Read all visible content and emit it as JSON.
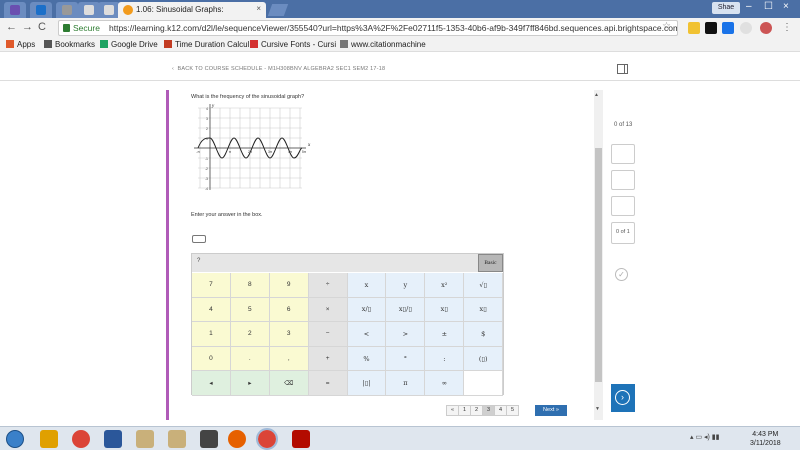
{
  "browser": {
    "active_tab_title": "1.06: Sinusoidal Graphs:",
    "tab_close": "×",
    "user_chip": "Shae",
    "window_controls": [
      "–",
      "☐",
      "×"
    ],
    "secure_label": "Secure",
    "url": "https://learning.k12.com/d2l/le/sequenceViewer/355540?url=https%3A%2F%2Fe02711f5-1353-40b6-af9b-349f7ff846bd.sequences.api.brightspace.com%2F...",
    "back_label": "←",
    "forward_label": "→",
    "reload_label": "C",
    "star_label": "☆",
    "bookmarks": [
      {
        "label": "Apps",
        "color": "#e05a2b"
      },
      {
        "label": "Bookmarks",
        "color": "#555555"
      },
      {
        "label": "Google Drive",
        "color": "#1ea362"
      },
      {
        "label": "Time Duration Calcul",
        "color": "#c23b22"
      },
      {
        "label": "Cursive Fonts - Cursi",
        "color": "#d32f2f"
      },
      {
        "label": "www.citationmachine",
        "color": "#777777"
      }
    ]
  },
  "page": {
    "back_link": "BACK TO COURSE SCHEDULE - M1H308BNV ALGEBRA2 SEC1 SEM2 17-18",
    "question": "What is the frequency of the sinusoidal graph?",
    "prompt": "Enter your answer in the box.",
    "graph": {
      "x_label": "x",
      "y_label": "y",
      "y_ticks": [
        "4",
        "3",
        "2",
        "1",
        "-1",
        "-2",
        "-3",
        "-4"
      ],
      "x_ticks": [
        "-π",
        "π",
        "2π",
        "3π",
        "4π",
        "5π"
      ]
    },
    "keypad": {
      "help": "?",
      "mode": "Basic",
      "rows": [
        [
          {
            "t": "7",
            "k": "num"
          },
          {
            "t": "8",
            "k": "num"
          },
          {
            "t": "9",
            "k": "num"
          },
          {
            "t": "÷",
            "k": "op"
          },
          {
            "t": "x",
            "k": "fn"
          },
          {
            "t": "y",
            "k": "fn"
          },
          {
            "t": "x²",
            "k": "fn"
          },
          {
            "t": "√▯",
            "k": "fn"
          }
        ],
        [
          {
            "t": "4",
            "k": "num"
          },
          {
            "t": "5",
            "k": "num"
          },
          {
            "t": "6",
            "k": "num"
          },
          {
            "t": "×",
            "k": "op"
          },
          {
            "t": "x/▯",
            "k": "fn"
          },
          {
            "t": "x▯/▯",
            "k": "fn"
          },
          {
            "t": "x▯",
            "k": "fn"
          },
          {
            "t": "x▯",
            "k": "fn"
          }
        ],
        [
          {
            "t": "1",
            "k": "num"
          },
          {
            "t": "2",
            "k": "num"
          },
          {
            "t": "3",
            "k": "num"
          },
          {
            "t": "−",
            "k": "op"
          },
          {
            "t": "<",
            "k": "fn"
          },
          {
            "t": ">",
            "k": "fn"
          },
          {
            "t": "±",
            "k": "fn"
          },
          {
            "t": "$",
            "k": "fn"
          }
        ],
        [
          {
            "t": "0",
            "k": "num"
          },
          {
            "t": ".",
            "k": "num"
          },
          {
            "t": ",",
            "k": "num"
          },
          {
            "t": "+",
            "k": "op"
          },
          {
            "t": "%",
            "k": "fn"
          },
          {
            "t": "°",
            "k": "fn"
          },
          {
            "t": ":",
            "k": "fn"
          },
          {
            "t": "(▯)",
            "k": "fn"
          }
        ],
        [
          {
            "t": "◂",
            "k": "nav"
          },
          {
            "t": "▸",
            "k": "nav"
          },
          {
            "t": "⌫",
            "k": "nav"
          },
          {
            "t": "=",
            "k": "op"
          },
          {
            "t": "|▯|",
            "k": "fn"
          },
          {
            "t": "π",
            "k": "fn"
          },
          {
            "t": "∞",
            "k": "fn"
          },
          {
            "t": "",
            "k": "blank"
          }
        ]
      ]
    },
    "pager": [
      "«",
      "1",
      "2",
      "3",
      "4",
      "5"
    ],
    "pager_active": "3",
    "next_label": "Next »",
    "right_count": "0 of 13",
    "right_count2": "0 of 1",
    "check_label": "✓",
    "circle_next": "›"
  },
  "taskbar": {
    "time": "4:43 PM",
    "date": "3/11/2018",
    "tray": "▴ ▭ ◂) ▮▮"
  }
}
